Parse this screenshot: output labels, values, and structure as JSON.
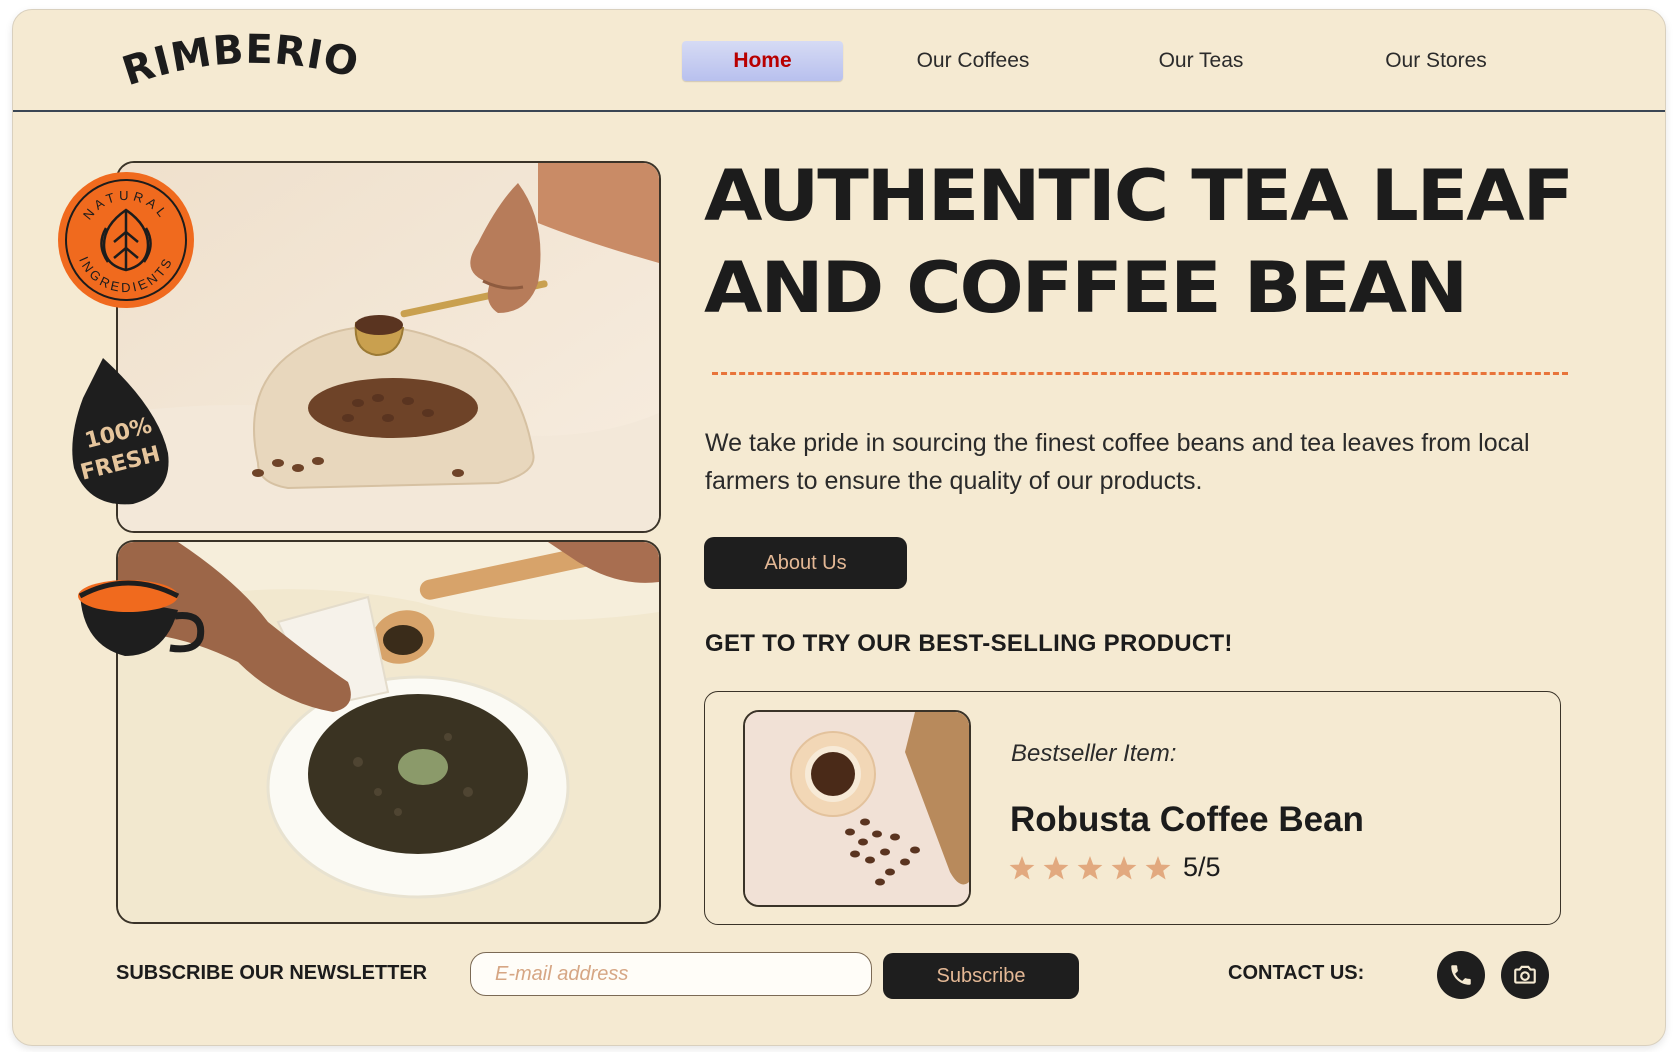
{
  "brand": {
    "logo_text": "RIMBERIO"
  },
  "nav": {
    "items": [
      {
        "label": "Home",
        "active": true
      },
      {
        "label": "Our Coffees"
      },
      {
        "label": "Our Teas"
      },
      {
        "label": "Our Stores"
      }
    ]
  },
  "badges": {
    "natural_top": "NATURAL",
    "natural_bottom": "INGREDIENTS",
    "fresh_line1": "100%",
    "fresh_line2": "FRESH"
  },
  "hero": {
    "title_line1": "AUTHENTIC TEA LEAF",
    "title_line2": "AND COFFEE BEAN",
    "description": "We take pride in sourcing the finest coffee beans and tea leaves from local farmers to ensure the quality of our products.",
    "about_button": "About Us"
  },
  "bestseller": {
    "heading": "GET TO TRY OUR BEST-SELLING PRODUCT!",
    "label": "Bestseller Item:",
    "product_name": "Robusta Coffee Bean",
    "stars": 5,
    "rating_text": "5/5"
  },
  "footer": {
    "newsletter_label": "SUBSCRIBE OUR NEWSLETTER",
    "email_placeholder": "E-mail address",
    "subscribe_button": "Subscribe",
    "contact_label": "CONTACT US:",
    "contact_icons": [
      "phone-icon",
      "camera-icon"
    ]
  },
  "colors": {
    "background": "#f5ead2",
    "accent_orange": "#f06a1e",
    "dark": "#1e1e1e",
    "button_text": "#e4b895",
    "nav_active_text": "#b80000",
    "star": "#e2a97f"
  }
}
